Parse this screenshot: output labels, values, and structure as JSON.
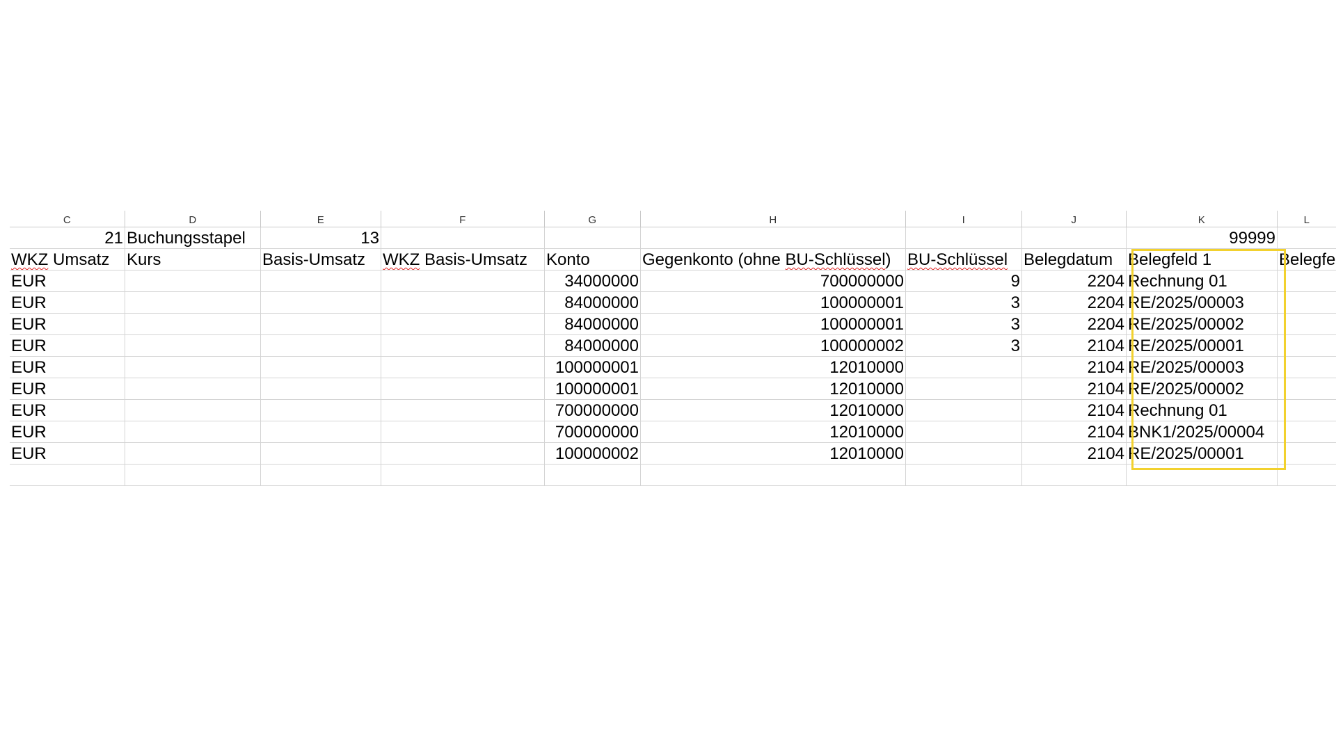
{
  "columns": [
    "C",
    "D",
    "E",
    "F",
    "G",
    "H",
    "I",
    "J",
    "K",
    "L"
  ],
  "row1": {
    "c": "21",
    "d": "Buchungsstapel",
    "e": "13",
    "k": "99999"
  },
  "headers": {
    "c_a": "WKZ",
    "c_b": " Umsatz",
    "d": "Kurs",
    "e": "Basis-Umsatz",
    "f_a": "WKZ",
    "f_b": " Basis-Umsatz",
    "g": "Konto",
    "h_a": "Gegenkonto (ohne ",
    "h_b": "BU-Schlüssel",
    "h_c": ")",
    "i": "BU-Schlüssel",
    "j": "Belegdatum",
    "k": "Belegfeld 1",
    "l": "Belegfe"
  },
  "rows": [
    {
      "currency": "EUR",
      "konto": "34000000",
      "gegenkonto": "700000000",
      "bu": "9",
      "datum": "2204",
      "beleg": "Rechnung 01"
    },
    {
      "currency": "EUR",
      "konto": "84000000",
      "gegenkonto": "100000001",
      "bu": "3",
      "datum": "2204",
      "beleg": "RE/2025/00003"
    },
    {
      "currency": "EUR",
      "konto": "84000000",
      "gegenkonto": "100000001",
      "bu": "3",
      "datum": "2204",
      "beleg": "RE/2025/00002"
    },
    {
      "currency": "EUR",
      "konto": "84000000",
      "gegenkonto": "100000002",
      "bu": "3",
      "datum": "2104",
      "beleg": "RE/2025/00001"
    },
    {
      "currency": "EUR",
      "konto": "100000001",
      "gegenkonto": "12010000",
      "bu": "",
      "datum": "2104",
      "beleg": "RE/2025/00003"
    },
    {
      "currency": "EUR",
      "konto": "100000001",
      "gegenkonto": "12010000",
      "bu": "",
      "datum": "2104",
      "beleg": "RE/2025/00002"
    },
    {
      "currency": "EUR",
      "konto": "700000000",
      "gegenkonto": "12010000",
      "bu": "",
      "datum": "2104",
      "beleg": "Rechnung 01"
    },
    {
      "currency": "EUR",
      "konto": "700000000",
      "gegenkonto": "12010000",
      "bu": "",
      "datum": "2104",
      "beleg": "BNK1/2025/00004"
    },
    {
      "currency": "EUR",
      "konto": "100000002",
      "gegenkonto": "12010000",
      "bu": "",
      "datum": "2104",
      "beleg": "RE/2025/00001"
    }
  ],
  "colors": {
    "highlight": "#f2d12e",
    "spellcheck": "#e02020",
    "gridline": "#d4d4d4"
  }
}
